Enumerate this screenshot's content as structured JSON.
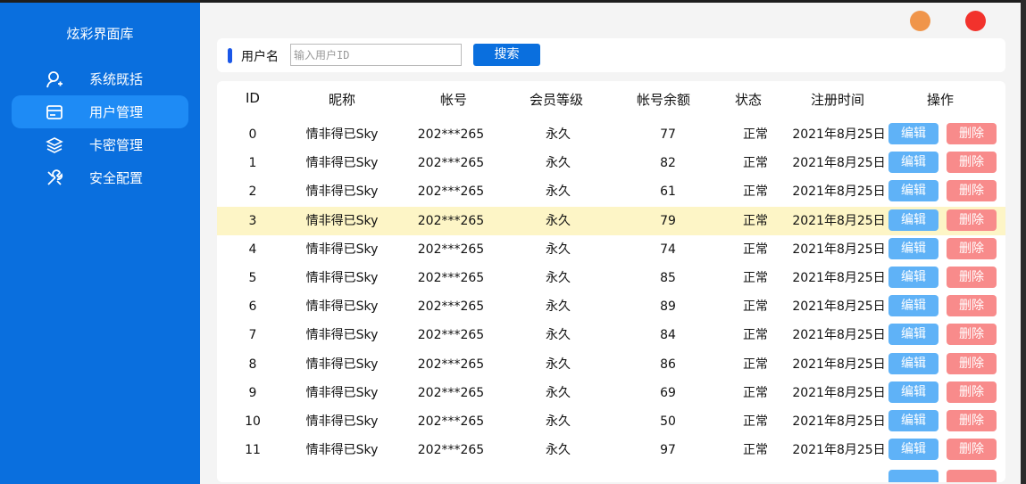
{
  "app": {
    "title": "炫彩界面库"
  },
  "sidebar": {
    "items": [
      {
        "label": "系统既括",
        "icon": "user-plus-icon",
        "active": false
      },
      {
        "label": "用户管理",
        "icon": "card-icon",
        "active": true
      },
      {
        "label": "卡密管理",
        "icon": "layers-icon",
        "active": false
      },
      {
        "label": "安全配置",
        "icon": "tools-icon",
        "active": false
      }
    ]
  },
  "window_controls": {
    "minimize_color": "#f0954a",
    "close_color": "#f2322c"
  },
  "search": {
    "label": "用户名",
    "placeholder": "输入用户ID",
    "value": "",
    "button_label": "搜索"
  },
  "table": {
    "columns": [
      "ID",
      "昵称",
      "帐号",
      "会员等级",
      "帐号余额",
      "状态",
      "注册时间",
      "操作"
    ],
    "edit_label": "编辑",
    "delete_label": "删除",
    "highlighted_row": 3,
    "rows": [
      {
        "id": "0",
        "nickname": "情非得已Sky",
        "account": "202***265",
        "level": "永久",
        "balance": "77",
        "status": "正常",
        "date": "2021年8月25日"
      },
      {
        "id": "1",
        "nickname": "情非得已Sky",
        "account": "202***265",
        "level": "永久",
        "balance": "82",
        "status": "正常",
        "date": "2021年8月25日"
      },
      {
        "id": "2",
        "nickname": "情非得已Sky",
        "account": "202***265",
        "level": "永久",
        "balance": "61",
        "status": "正常",
        "date": "2021年8月25日"
      },
      {
        "id": "3",
        "nickname": "情非得已Sky",
        "account": "202***265",
        "level": "永久",
        "balance": "79",
        "status": "正常",
        "date": "2021年8月25日"
      },
      {
        "id": "4",
        "nickname": "情非得已Sky",
        "account": "202***265",
        "level": "永久",
        "balance": "74",
        "status": "正常",
        "date": "2021年8月25日"
      },
      {
        "id": "5",
        "nickname": "情非得已Sky",
        "account": "202***265",
        "level": "永久",
        "balance": "85",
        "status": "正常",
        "date": "2021年8月25日"
      },
      {
        "id": "6",
        "nickname": "情非得已Sky",
        "account": "202***265",
        "level": "永久",
        "balance": "89",
        "status": "正常",
        "date": "2021年8月25日"
      },
      {
        "id": "7",
        "nickname": "情非得已Sky",
        "account": "202***265",
        "level": "永久",
        "balance": "84",
        "status": "正常",
        "date": "2021年8月25日"
      },
      {
        "id": "8",
        "nickname": "情非得已Sky",
        "account": "202***265",
        "level": "永久",
        "balance": "86",
        "status": "正常",
        "date": "2021年8月25日"
      },
      {
        "id": "9",
        "nickname": "情非得已Sky",
        "account": "202***265",
        "level": "永久",
        "balance": "69",
        "status": "正常",
        "date": "2021年8月25日"
      },
      {
        "id": "10",
        "nickname": "情非得已Sky",
        "account": "202***265",
        "level": "永久",
        "balance": "50",
        "status": "正常",
        "date": "2021年8月25日"
      },
      {
        "id": "11",
        "nickname": "情非得已Sky",
        "account": "202***265",
        "level": "永久",
        "balance": "97",
        "status": "正常",
        "date": "2021年8月25日"
      }
    ]
  }
}
